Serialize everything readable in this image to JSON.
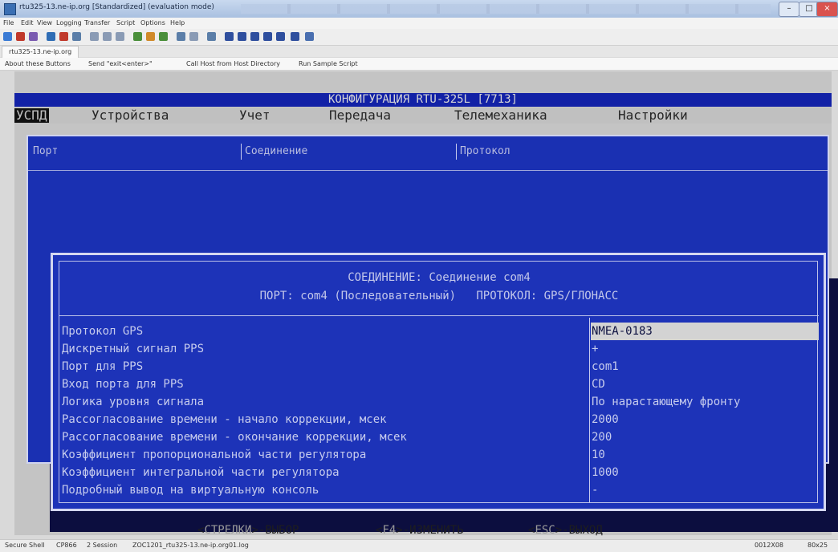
{
  "window": {
    "title": "rtu325-13.ne-ip.org [Standardized] (evaluation mode)",
    "controls": [
      "–",
      "□",
      "×"
    ]
  },
  "menubar": [
    "File",
    "Edit",
    "View",
    "Logging",
    "Transfer",
    "Script",
    "Options",
    "Help"
  ],
  "session_tab": "rtu325-13.ne-ip.org",
  "button_bar": [
    "About these Buttons",
    "Send \"exit<enter>\"",
    "Call Host from Host Directory",
    "Run Sample Script"
  ],
  "terminal": {
    "title": "КОНФИГУРАЦИЯ RTU-325L [7713]",
    "menu": [
      "УСПД",
      "Устройства",
      "Учет",
      "Передача",
      "Телемеханика",
      "Настройки"
    ],
    "menu_active": "УСПД",
    "tabs": [
      "Порт",
      "Соединение",
      "Протокол"
    ],
    "dialog": {
      "header_line1": "СОЕДИНЕНИЕ: Соединение com4",
      "header_line2": "ПОРТ: com4 (Последовательный)   ПРОТОКОЛ: GPS/ГЛОНАСС",
      "params": [
        {
          "label": "Протокол GPS",
          "value": "NMEA-0183",
          "selected": true
        },
        {
          "label": "Дискретный сигнал PPS",
          "value": "+"
        },
        {
          "label": "Порт для PPS",
          "value": "com1"
        },
        {
          "label": "Вход порта для PPS",
          "value": "CD"
        },
        {
          "label": "Логика уровня сигнала",
          "value": "По нарастающему фронту"
        },
        {
          "label": "Рассогласование времени - начало коррекции, мсек",
          "value": "2000"
        },
        {
          "label": "Рассогласование времени - окончание коррекции, мсек",
          "value": "200"
        },
        {
          "label": "Коэффициент пропорциональной части регулятора",
          "value": "10"
        },
        {
          "label": "Коэффициент интегральной части регулятора",
          "value": "1000"
        },
        {
          "label": "Подробный вывод на виртуальную консоль",
          "value": "-"
        }
      ]
    },
    "footer": {
      "k1": "СТРЕЛКИ",
      "a1": "ВЫБОР",
      "k2": "F4",
      "a2": "ИЗМЕНИТЬ",
      "k3": "ESC",
      "a3": "ВЫХОД"
    }
  },
  "statusbar": [
    "Secure Shell",
    "CP866",
    "2 Session",
    "ZOC1201_rtu325-13.ne-ip.org01.log",
    "0012X08",
    "80x25"
  ]
}
